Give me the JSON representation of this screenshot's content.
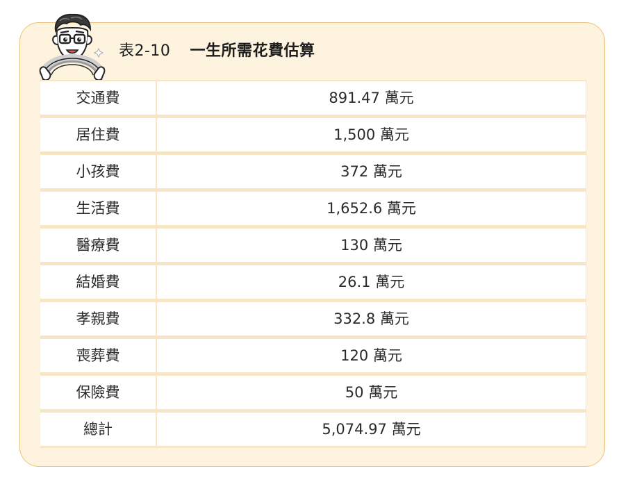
{
  "title": {
    "label": "表2-10",
    "text": "一生所需花費估算"
  },
  "rows": [
    {
      "name": "交通費",
      "value": "891.47 萬元"
    },
    {
      "name": "居住費",
      "value": "1,500 萬元"
    },
    {
      "name": "小孩費",
      "value": "372 萬元"
    },
    {
      "name": "生活費",
      "value": "1,652.6 萬元"
    },
    {
      "name": "醫療費",
      "value": "130 萬元"
    },
    {
      "name": "結婚費",
      "value": "26.1 萬元"
    },
    {
      "name": "孝親費",
      "value": "332.8 萬元"
    },
    {
      "name": "喪葬費",
      "value": "120 萬元"
    },
    {
      "name": "保險費",
      "value": "50 萬元"
    },
    {
      "name": "總計",
      "value": "5,074.97 萬元"
    }
  ],
  "colors": {
    "panel_bg": "#fdf3df",
    "panel_border": "#ecc27a",
    "grid": "#f7e6c5",
    "cell": "#ffffff"
  },
  "icons": {
    "mascot": "cartoon-man-with-glasses-holding-rainbow-icon"
  }
}
